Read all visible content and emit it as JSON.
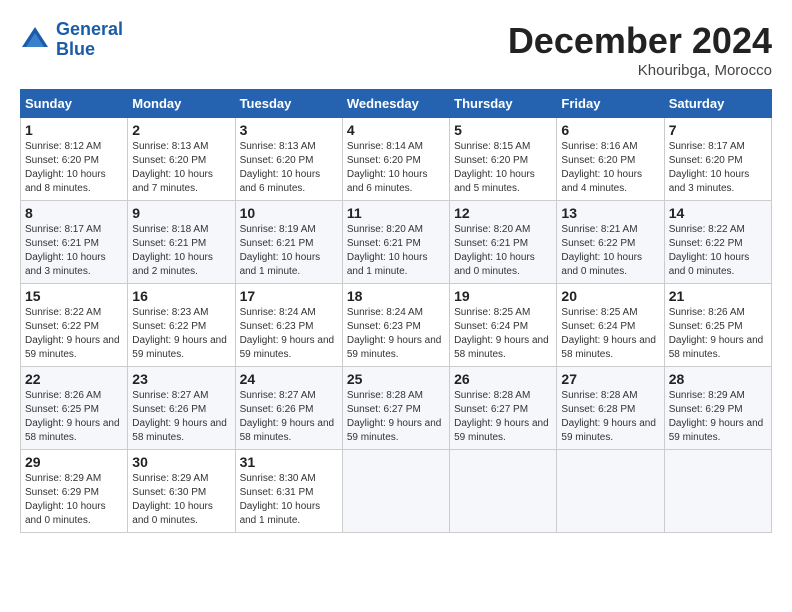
{
  "header": {
    "logo_line1": "General",
    "logo_line2": "Blue",
    "month": "December 2024",
    "location": "Khouribga, Morocco"
  },
  "weekdays": [
    "Sunday",
    "Monday",
    "Tuesday",
    "Wednesday",
    "Thursday",
    "Friday",
    "Saturday"
  ],
  "weeks": [
    [
      {
        "day": "1",
        "sunrise": "Sunrise: 8:12 AM",
        "sunset": "Sunset: 6:20 PM",
        "daylight": "Daylight: 10 hours and 8 minutes."
      },
      {
        "day": "2",
        "sunrise": "Sunrise: 8:13 AM",
        "sunset": "Sunset: 6:20 PM",
        "daylight": "Daylight: 10 hours and 7 minutes."
      },
      {
        "day": "3",
        "sunrise": "Sunrise: 8:13 AM",
        "sunset": "Sunset: 6:20 PM",
        "daylight": "Daylight: 10 hours and 6 minutes."
      },
      {
        "day": "4",
        "sunrise": "Sunrise: 8:14 AM",
        "sunset": "Sunset: 6:20 PM",
        "daylight": "Daylight: 10 hours and 6 minutes."
      },
      {
        "day": "5",
        "sunrise": "Sunrise: 8:15 AM",
        "sunset": "Sunset: 6:20 PM",
        "daylight": "Daylight: 10 hours and 5 minutes."
      },
      {
        "day": "6",
        "sunrise": "Sunrise: 8:16 AM",
        "sunset": "Sunset: 6:20 PM",
        "daylight": "Daylight: 10 hours and 4 minutes."
      },
      {
        "day": "7",
        "sunrise": "Sunrise: 8:17 AM",
        "sunset": "Sunset: 6:20 PM",
        "daylight": "Daylight: 10 hours and 3 minutes."
      }
    ],
    [
      {
        "day": "8",
        "sunrise": "Sunrise: 8:17 AM",
        "sunset": "Sunset: 6:21 PM",
        "daylight": "Daylight: 10 hours and 3 minutes."
      },
      {
        "day": "9",
        "sunrise": "Sunrise: 8:18 AM",
        "sunset": "Sunset: 6:21 PM",
        "daylight": "Daylight: 10 hours and 2 minutes."
      },
      {
        "day": "10",
        "sunrise": "Sunrise: 8:19 AM",
        "sunset": "Sunset: 6:21 PM",
        "daylight": "Daylight: 10 hours and 1 minute."
      },
      {
        "day": "11",
        "sunrise": "Sunrise: 8:20 AM",
        "sunset": "Sunset: 6:21 PM",
        "daylight": "Daylight: 10 hours and 1 minute."
      },
      {
        "day": "12",
        "sunrise": "Sunrise: 8:20 AM",
        "sunset": "Sunset: 6:21 PM",
        "daylight": "Daylight: 10 hours and 0 minutes."
      },
      {
        "day": "13",
        "sunrise": "Sunrise: 8:21 AM",
        "sunset": "Sunset: 6:22 PM",
        "daylight": "Daylight: 10 hours and 0 minutes."
      },
      {
        "day": "14",
        "sunrise": "Sunrise: 8:22 AM",
        "sunset": "Sunset: 6:22 PM",
        "daylight": "Daylight: 10 hours and 0 minutes."
      }
    ],
    [
      {
        "day": "15",
        "sunrise": "Sunrise: 8:22 AM",
        "sunset": "Sunset: 6:22 PM",
        "daylight": "Daylight: 9 hours and 59 minutes."
      },
      {
        "day": "16",
        "sunrise": "Sunrise: 8:23 AM",
        "sunset": "Sunset: 6:22 PM",
        "daylight": "Daylight: 9 hours and 59 minutes."
      },
      {
        "day": "17",
        "sunrise": "Sunrise: 8:24 AM",
        "sunset": "Sunset: 6:23 PM",
        "daylight": "Daylight: 9 hours and 59 minutes."
      },
      {
        "day": "18",
        "sunrise": "Sunrise: 8:24 AM",
        "sunset": "Sunset: 6:23 PM",
        "daylight": "Daylight: 9 hours and 59 minutes."
      },
      {
        "day": "19",
        "sunrise": "Sunrise: 8:25 AM",
        "sunset": "Sunset: 6:24 PM",
        "daylight": "Daylight: 9 hours and 58 minutes."
      },
      {
        "day": "20",
        "sunrise": "Sunrise: 8:25 AM",
        "sunset": "Sunset: 6:24 PM",
        "daylight": "Daylight: 9 hours and 58 minutes."
      },
      {
        "day": "21",
        "sunrise": "Sunrise: 8:26 AM",
        "sunset": "Sunset: 6:25 PM",
        "daylight": "Daylight: 9 hours and 58 minutes."
      }
    ],
    [
      {
        "day": "22",
        "sunrise": "Sunrise: 8:26 AM",
        "sunset": "Sunset: 6:25 PM",
        "daylight": "Daylight: 9 hours and 58 minutes."
      },
      {
        "day": "23",
        "sunrise": "Sunrise: 8:27 AM",
        "sunset": "Sunset: 6:26 PM",
        "daylight": "Daylight: 9 hours and 58 minutes."
      },
      {
        "day": "24",
        "sunrise": "Sunrise: 8:27 AM",
        "sunset": "Sunset: 6:26 PM",
        "daylight": "Daylight: 9 hours and 58 minutes."
      },
      {
        "day": "25",
        "sunrise": "Sunrise: 8:28 AM",
        "sunset": "Sunset: 6:27 PM",
        "daylight": "Daylight: 9 hours and 59 minutes."
      },
      {
        "day": "26",
        "sunrise": "Sunrise: 8:28 AM",
        "sunset": "Sunset: 6:27 PM",
        "daylight": "Daylight: 9 hours and 59 minutes."
      },
      {
        "day": "27",
        "sunrise": "Sunrise: 8:28 AM",
        "sunset": "Sunset: 6:28 PM",
        "daylight": "Daylight: 9 hours and 59 minutes."
      },
      {
        "day": "28",
        "sunrise": "Sunrise: 8:29 AM",
        "sunset": "Sunset: 6:29 PM",
        "daylight": "Daylight: 9 hours and 59 minutes."
      }
    ],
    [
      {
        "day": "29",
        "sunrise": "Sunrise: 8:29 AM",
        "sunset": "Sunset: 6:29 PM",
        "daylight": "Daylight: 10 hours and 0 minutes."
      },
      {
        "day": "30",
        "sunrise": "Sunrise: 8:29 AM",
        "sunset": "Sunset: 6:30 PM",
        "daylight": "Daylight: 10 hours and 0 minutes."
      },
      {
        "day": "31",
        "sunrise": "Sunrise: 8:30 AM",
        "sunset": "Sunset: 6:31 PM",
        "daylight": "Daylight: 10 hours and 1 minute."
      },
      null,
      null,
      null,
      null
    ]
  ]
}
